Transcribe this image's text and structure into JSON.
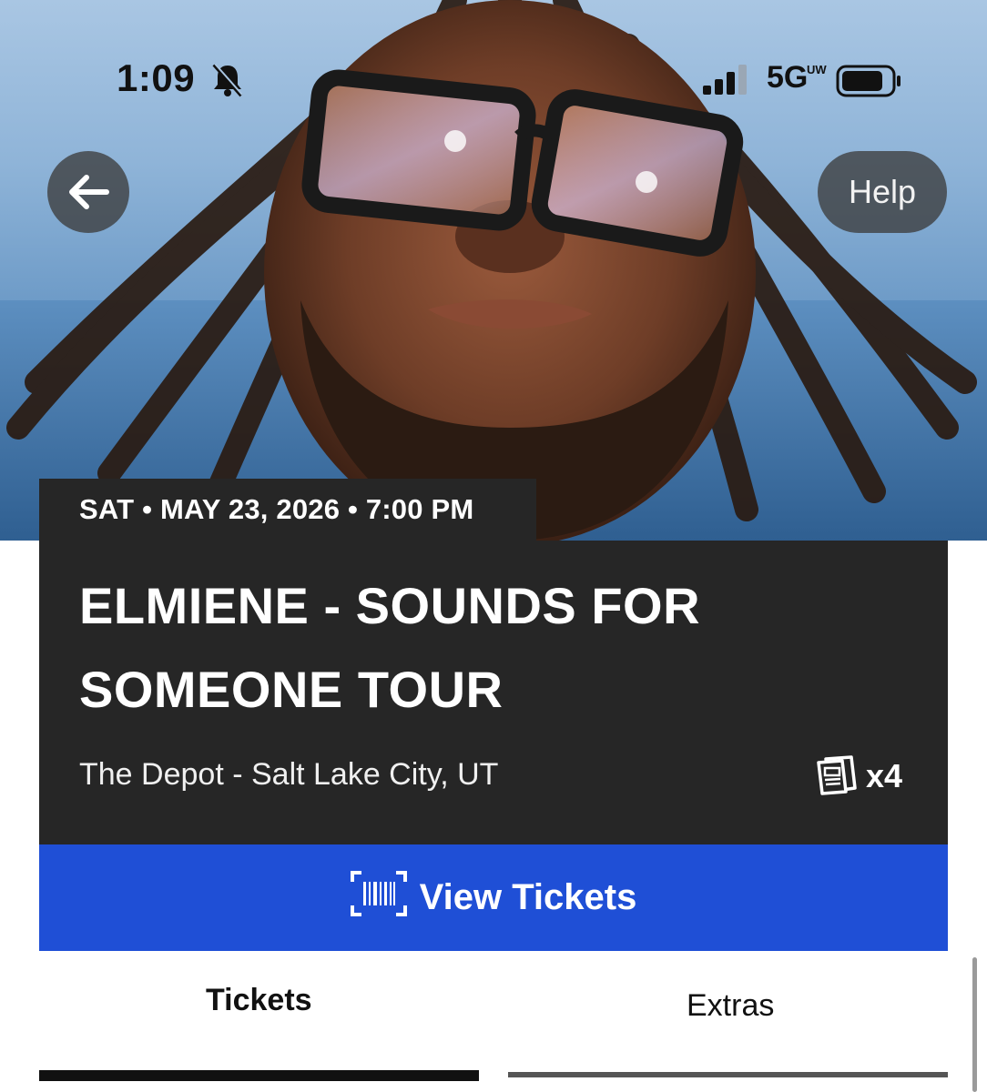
{
  "status_bar": {
    "time": "1:09",
    "network": "5G",
    "network_sub": "UW"
  },
  "header": {
    "help_label": "Help"
  },
  "event": {
    "date_line": "SAT • MAY 23, 2026 • 7:00 PM",
    "title": "ELMIENE - SOUNDS FOR SOMEONE TOUR",
    "venue": "The Depot - Salt Lake City, UT",
    "ticket_count": "x4"
  },
  "actions": {
    "view_tickets_label": "View Tickets"
  },
  "tabs": [
    {
      "label": "Tickets",
      "active": true
    },
    {
      "label": "Extras",
      "active": false
    }
  ],
  "icons": {
    "back": "arrow-left-icon",
    "bell": "bell-slash-icon",
    "signal": "signal-bars-icon",
    "battery": "battery-icon",
    "tickets": "ticket-stack-icon",
    "barcode": "barcode-icon"
  },
  "colors": {
    "card_background": "#262626",
    "primary_blue": "#1f4fd6",
    "tab_active": "#111111"
  }
}
